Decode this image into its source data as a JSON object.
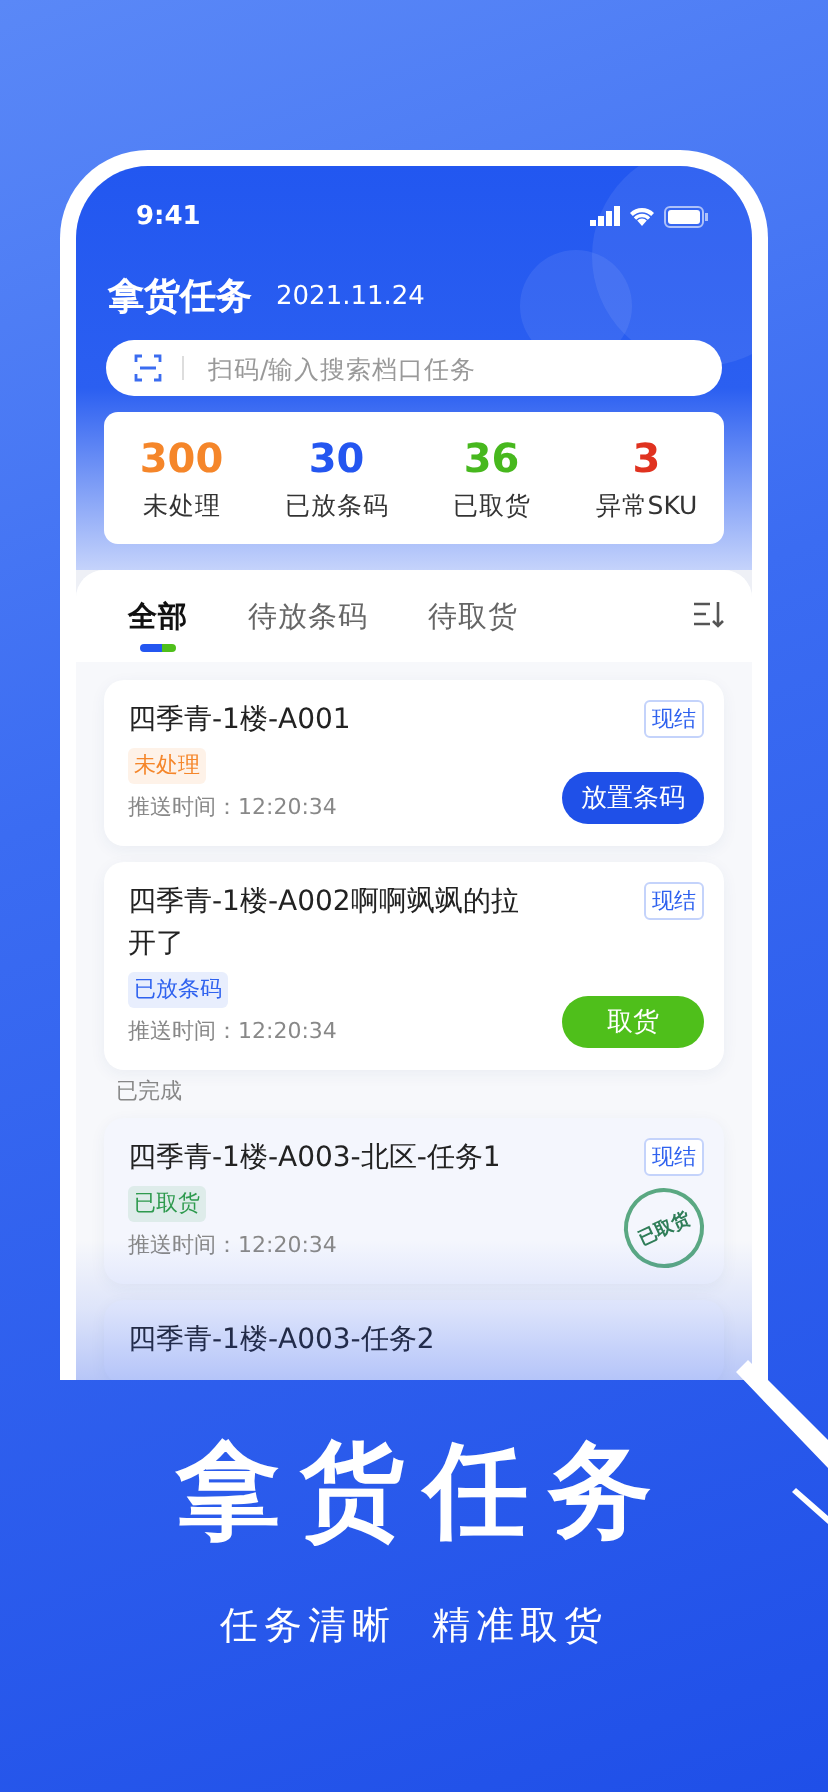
{
  "status_bar": {
    "time": "9:41"
  },
  "header": {
    "title": "拿货任务",
    "date": "2021.11.24"
  },
  "search": {
    "placeholder": "扫码/输入搜索档口任务"
  },
  "stats": [
    {
      "value": "300",
      "label": "未处理",
      "color": "#f5862a"
    },
    {
      "value": "30",
      "label": "已放条码",
      "color": "#2456f0"
    },
    {
      "value": "36",
      "label": "已取货",
      "color": "#47b81e"
    },
    {
      "value": "3",
      "label": "异常SKU",
      "color": "#e0321f"
    }
  ],
  "tabs": [
    {
      "label": "全部",
      "selected": true
    },
    {
      "label": "待放条码",
      "selected": false
    },
    {
      "label": "待取货",
      "selected": false
    }
  ],
  "tasks": [
    {
      "title": "四季青-1楼-A001",
      "tag": "现结",
      "status": {
        "label": "未处理",
        "color": "#f5862a"
      },
      "time": "推送时间：12:20:34",
      "button": {
        "label": "放置条码",
        "color": "#1f50e8"
      }
    },
    {
      "title": "四季青-1楼-A002啊啊飒飒的拉开了",
      "tag": "现结",
      "status": {
        "label": "已放条码",
        "color": "#2f62ef"
      },
      "time": "推送时间：12:20:34",
      "button": {
        "label": "取货",
        "color": "#4fbf1b"
      }
    }
  ],
  "completed": {
    "title": "已完成",
    "tasks": [
      {
        "title": "四季青-1楼-A003-北区-任务1",
        "tag": "现结",
        "status": {
          "label": "已取货",
          "color": "#2e9a4e"
        },
        "time": "推送时间：12:20:34",
        "stamp": "已取货"
      },
      {
        "title": "四季青-1楼-A003-任务2"
      }
    ]
  },
  "promo": {
    "title": "拿货任务",
    "subtitle": [
      "任务清晰",
      "精准取货"
    ]
  }
}
